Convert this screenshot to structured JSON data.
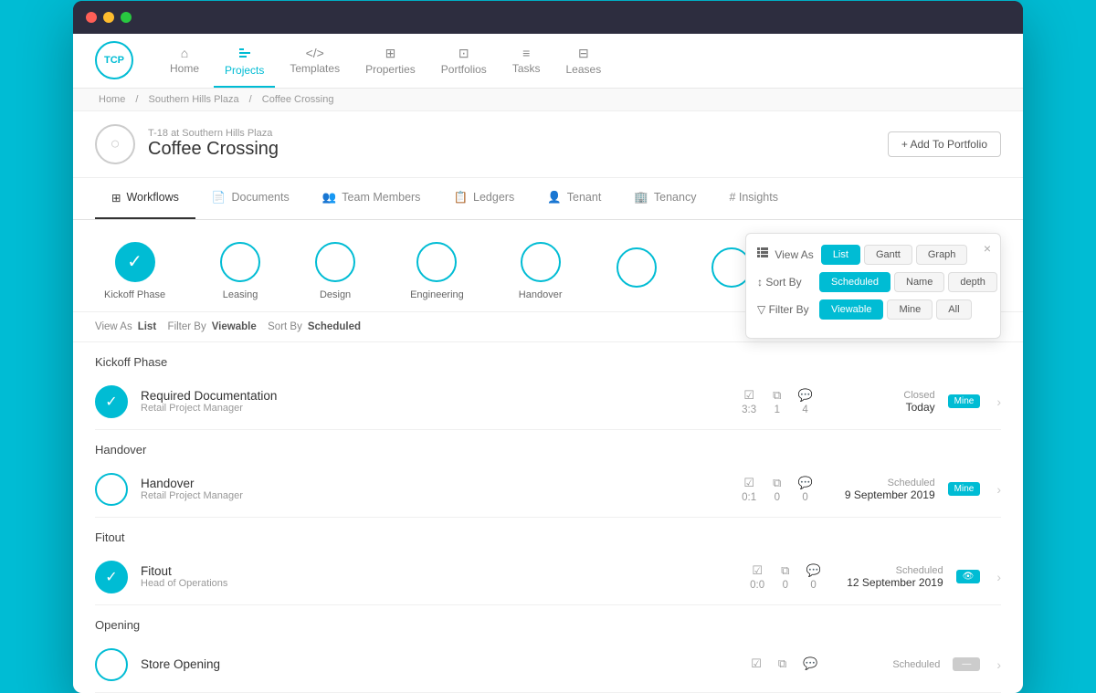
{
  "browser": {
    "traffic_lights": [
      "red",
      "yellow",
      "green"
    ]
  },
  "nav": {
    "logo": "TCP",
    "items": [
      {
        "label": "Home",
        "icon": "⌂",
        "active": false
      },
      {
        "label": "Projects",
        "icon": "◈",
        "active": true
      },
      {
        "label": "Templates",
        "icon": "</>",
        "active": false
      },
      {
        "label": "Properties",
        "icon": "⊞",
        "active": false
      },
      {
        "label": "Portfolios",
        "icon": "⊡",
        "active": false
      },
      {
        "label": "Tasks",
        "icon": "≡",
        "active": false
      },
      {
        "label": "Leases",
        "icon": "⊟",
        "active": false
      }
    ]
  },
  "breadcrumb": {
    "items": [
      "Home",
      "/",
      "Southern Hills Plaza",
      "/",
      "Coffee Crossing"
    ]
  },
  "project": {
    "subtitle": "T-18 at Southern Hills Plaza",
    "title": "Coffee Crossing",
    "add_portfolio_label": "+ Add To Portfolio"
  },
  "tabs": [
    {
      "label": "Workflows",
      "icon": "⊞",
      "active": true
    },
    {
      "label": "Documents",
      "icon": "📄",
      "active": false
    },
    {
      "label": "Team Members",
      "icon": "👥",
      "active": false
    },
    {
      "label": "Ledgers",
      "icon": "📋",
      "active": false
    },
    {
      "label": "Tenant",
      "icon": "👤",
      "active": false
    },
    {
      "label": "Tenancy",
      "icon": "🏢",
      "active": false
    },
    {
      "label": "# Insights",
      "icon": "",
      "active": false
    }
  ],
  "workflow_steps": [
    {
      "label": "Kickoff Phase",
      "completed": true
    },
    {
      "label": "Leasing",
      "completed": false
    },
    {
      "label": "Design",
      "completed": false
    },
    {
      "label": "Engineering",
      "completed": false
    },
    {
      "label": "Handover",
      "completed": false
    },
    {
      "label": "",
      "completed": false
    },
    {
      "label": "",
      "completed": false
    }
  ],
  "view_controls": {
    "view_as_label": "View As",
    "view_as_value": "List",
    "filter_by_label": "Filter By",
    "filter_by_value": "Viewable",
    "sort_by_label": "Sort By",
    "sort_by_value": "Scheduled"
  },
  "phases": [
    {
      "name": "Kickoff Phase",
      "rows": [
        {
          "title": "Required Documentation",
          "subtitle": "Retail Project Manager",
          "completed": true,
          "tasks": "3:3",
          "copies": "1",
          "comments": "4",
          "status": "Closed",
          "date": "Today",
          "badge_type": "mine"
        }
      ]
    },
    {
      "name": "Handover",
      "rows": [
        {
          "title": "Handover",
          "subtitle": "Retail Project Manager",
          "completed": false,
          "tasks": "0:1",
          "copies": "0",
          "comments": "0",
          "status": "Scheduled",
          "date": "9 September 2019",
          "badge_type": "mine"
        }
      ]
    },
    {
      "name": "Fitout",
      "rows": [
        {
          "title": "Fitout",
          "subtitle": "Head of Operations",
          "completed": true,
          "tasks": "0:0",
          "copies": "0",
          "comments": "0",
          "status": "Scheduled",
          "date": "12 September 2019",
          "badge_type": "eye"
        }
      ]
    },
    {
      "name": "Opening",
      "rows": [
        {
          "title": "Store Opening",
          "subtitle": "",
          "completed": false,
          "tasks": "",
          "copies": "",
          "comments": "",
          "status": "Scheduled",
          "date": "",
          "badge_type": "dash"
        }
      ]
    }
  ],
  "popup": {
    "view_as_label": "View As",
    "sort_by_label": "Sort By",
    "filter_by_label": "Filter By",
    "view_options": [
      "List",
      "Gantt",
      "Graph"
    ],
    "sort_options": [
      "Scheduled",
      "Name",
      "depth"
    ],
    "filter_options": [
      "Viewable",
      "Mine",
      "All"
    ],
    "active_view": "List",
    "active_sort": "Scheduled",
    "active_filter": "Viewable",
    "close_label": "×"
  }
}
